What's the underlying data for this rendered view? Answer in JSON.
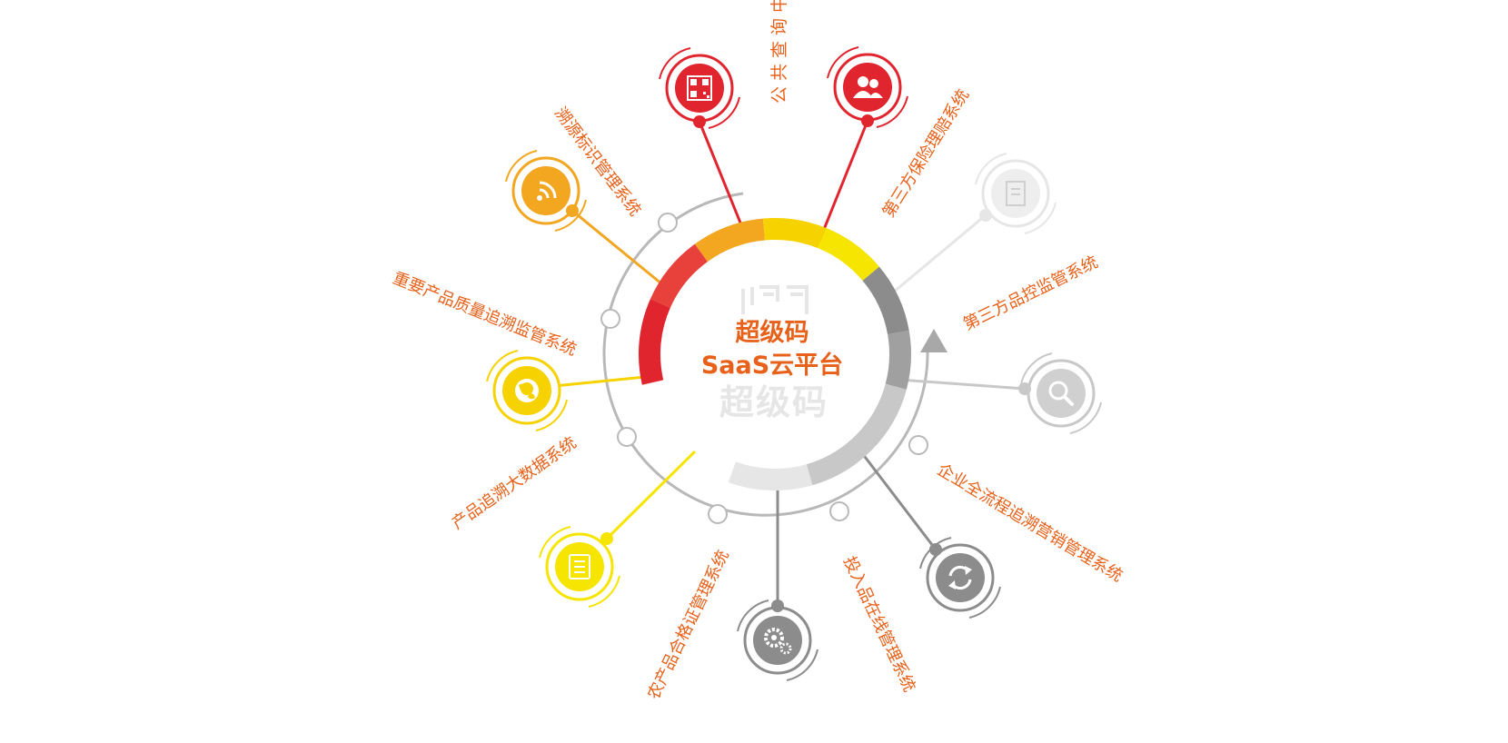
{
  "center": {
    "title_line1": "超级码",
    "title_line2": "SaaS云平台",
    "watermark": "超级码",
    "watermark_logo": "师码"
  },
  "systems": [
    {
      "label": "公共查询中心",
      "icon": "qr-code-icon",
      "color": "#e1252e"
    },
    {
      "label": "第三方保险理赔系统",
      "icon": "people-icon",
      "color": "#e1252e"
    },
    {
      "label": "第三方品控监管系统",
      "icon": "document-icon",
      "color": "#e6e6e6"
    },
    {
      "label": "企业全流程追溯营销管理系统",
      "icon": "search-icon",
      "color": "#c8c8c8"
    },
    {
      "label": "投入品在线管理系统",
      "icon": "refresh-icon",
      "color": "#8c8c8c"
    },
    {
      "label": "农产品合格证管理系统",
      "icon": "gears-icon",
      "color": "#8c8c8c"
    },
    {
      "label": "产品追溯大数据系统",
      "icon": "list-icon",
      "color": "#f6e500"
    },
    {
      "label": "重要产品质量追溯监管系统",
      "icon": "globe-icon",
      "color": "#f6d200"
    },
    {
      "label": "溯源标识管理系统",
      "icon": "wifi-icon",
      "color": "#f3a620"
    }
  ],
  "ring_colors": [
    "#e1252e",
    "#e8403a",
    "#f3a620",
    "#f6d200",
    "#f6e500",
    "#8c8c8c",
    "#a0a0a0",
    "#c8c8c8",
    "#e6e6e6"
  ],
  "accent": "#e8611a"
}
